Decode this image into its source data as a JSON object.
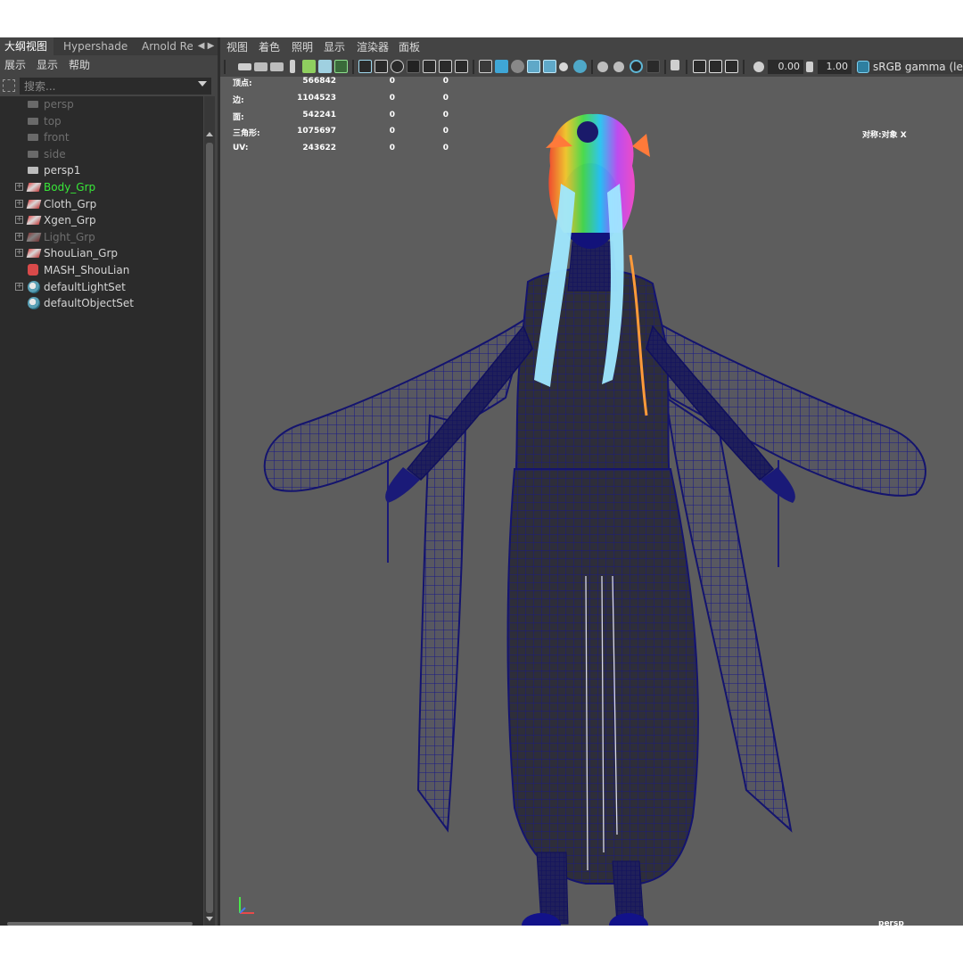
{
  "outliner": {
    "tabs": [
      "大纲视图",
      "Hypershade",
      "Arnold Re"
    ],
    "menu": [
      "展示",
      "显示",
      "帮助"
    ],
    "search_placeholder": "搜索...",
    "items": [
      {
        "label": "persp",
        "icon": "camera-icon",
        "state": "dim"
      },
      {
        "label": "top",
        "icon": "camera-icon",
        "state": "dim"
      },
      {
        "label": "front",
        "icon": "camera-icon",
        "state": "dim"
      },
      {
        "label": "side",
        "icon": "camera-icon",
        "state": "dim"
      },
      {
        "label": "persp1",
        "icon": "camera-icon",
        "state": "normal"
      },
      {
        "label": "Body_Grp",
        "icon": "group-icon",
        "state": "selected",
        "expandable": true
      },
      {
        "label": "Cloth_Grp",
        "icon": "group-icon",
        "state": "normal",
        "expandable": true
      },
      {
        "label": "Xgen_Grp",
        "icon": "group-icon",
        "state": "normal",
        "expandable": true
      },
      {
        "label": "Light_Grp",
        "icon": "group-icon",
        "state": "dim",
        "expandable": true
      },
      {
        "label": "ShouLian_Grp",
        "icon": "group-icon",
        "state": "normal",
        "expandable": true
      },
      {
        "label": "MASH_ShouLian",
        "icon": "mash-icon",
        "state": "normal"
      },
      {
        "label": "defaultLightSet",
        "icon": "set-icon",
        "state": "normal",
        "expandable": true
      },
      {
        "label": "defaultObjectSet",
        "icon": "set-icon",
        "state": "normal"
      }
    ]
  },
  "viewport": {
    "menu": [
      "视图",
      "着色",
      "照明",
      "显示",
      "渲染器",
      "面板"
    ],
    "toolbar": {
      "exposure": "0.00",
      "gamma": "1.00",
      "color_space": "sRGB gamma (legacy)"
    },
    "hud": [
      {
        "label": "顶点:",
        "v1": "566842",
        "v2": "0",
        "v3": "0"
      },
      {
        "label": "边:",
        "v1": "1104523",
        "v2": "0",
        "v3": "0"
      },
      {
        "label": "面:",
        "v1": "542241",
        "v2": "0",
        "v3": "0"
      },
      {
        "label": "三角形:",
        "v1": "1075697",
        "v2": "0",
        "v3": "0"
      },
      {
        "label": "UV:",
        "v1": "243622",
        "v2": "0",
        "v3": "0"
      }
    ],
    "symmetry": "对称:对象 X",
    "camera": "persp"
  },
  "colors": {
    "selected_text": "#38e838",
    "wireframe": "#1a1a7a",
    "viewport_bg": "#5d5d5d"
  }
}
